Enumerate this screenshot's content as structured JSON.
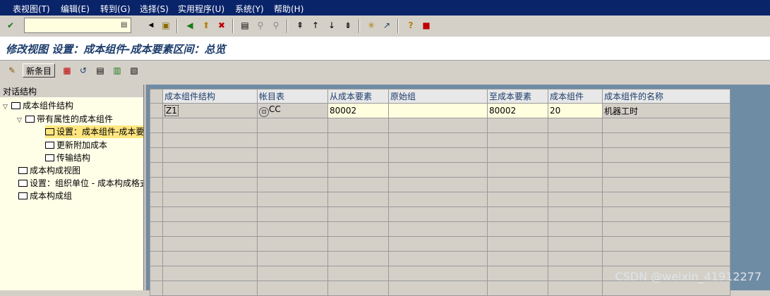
{
  "menu": [
    "表视图(T)",
    "编辑(E)",
    "转到(G)",
    "选择(S)",
    "实用程序(U)",
    "系统(Y)",
    "帮助(H)"
  ],
  "command_field": {
    "value": ""
  },
  "title": "修改视图 设置：成本组件-成本要素区间：总览",
  "app_toolbar": {
    "new_entry_label": "新条目"
  },
  "tree": {
    "header": "对话结构",
    "nodes": [
      {
        "label": "成本组件结构"
      },
      {
        "label": "带有属性的成本组件"
      },
      {
        "label": "设置：成本组件-成本要"
      },
      {
        "label": "更新附加成本"
      },
      {
        "label": "传输结构"
      },
      {
        "label": "成本构成视图"
      },
      {
        "label": "设置：组织单位 - 成本构成格式"
      },
      {
        "label": "成本构成组"
      }
    ]
  },
  "table": {
    "columns": [
      "成本组件结构",
      "帐目表",
      "从成本要素",
      "原始组",
      "至成本要素",
      "成本组件",
      "成本组件的名称"
    ],
    "rows": [
      [
        "Z1",
        "CC",
        "80002",
        "",
        "80002",
        "20",
        "机器工时"
      ]
    ]
  },
  "watermark": "CSDN @weixin_41912277",
  "colors": {
    "menubar": "#0a246a",
    "title_text": "#1c3c6c",
    "tree_bg": "#ffffe8",
    "input_bg": "#ffffe0",
    "table_frame": "#6f8ca5"
  }
}
